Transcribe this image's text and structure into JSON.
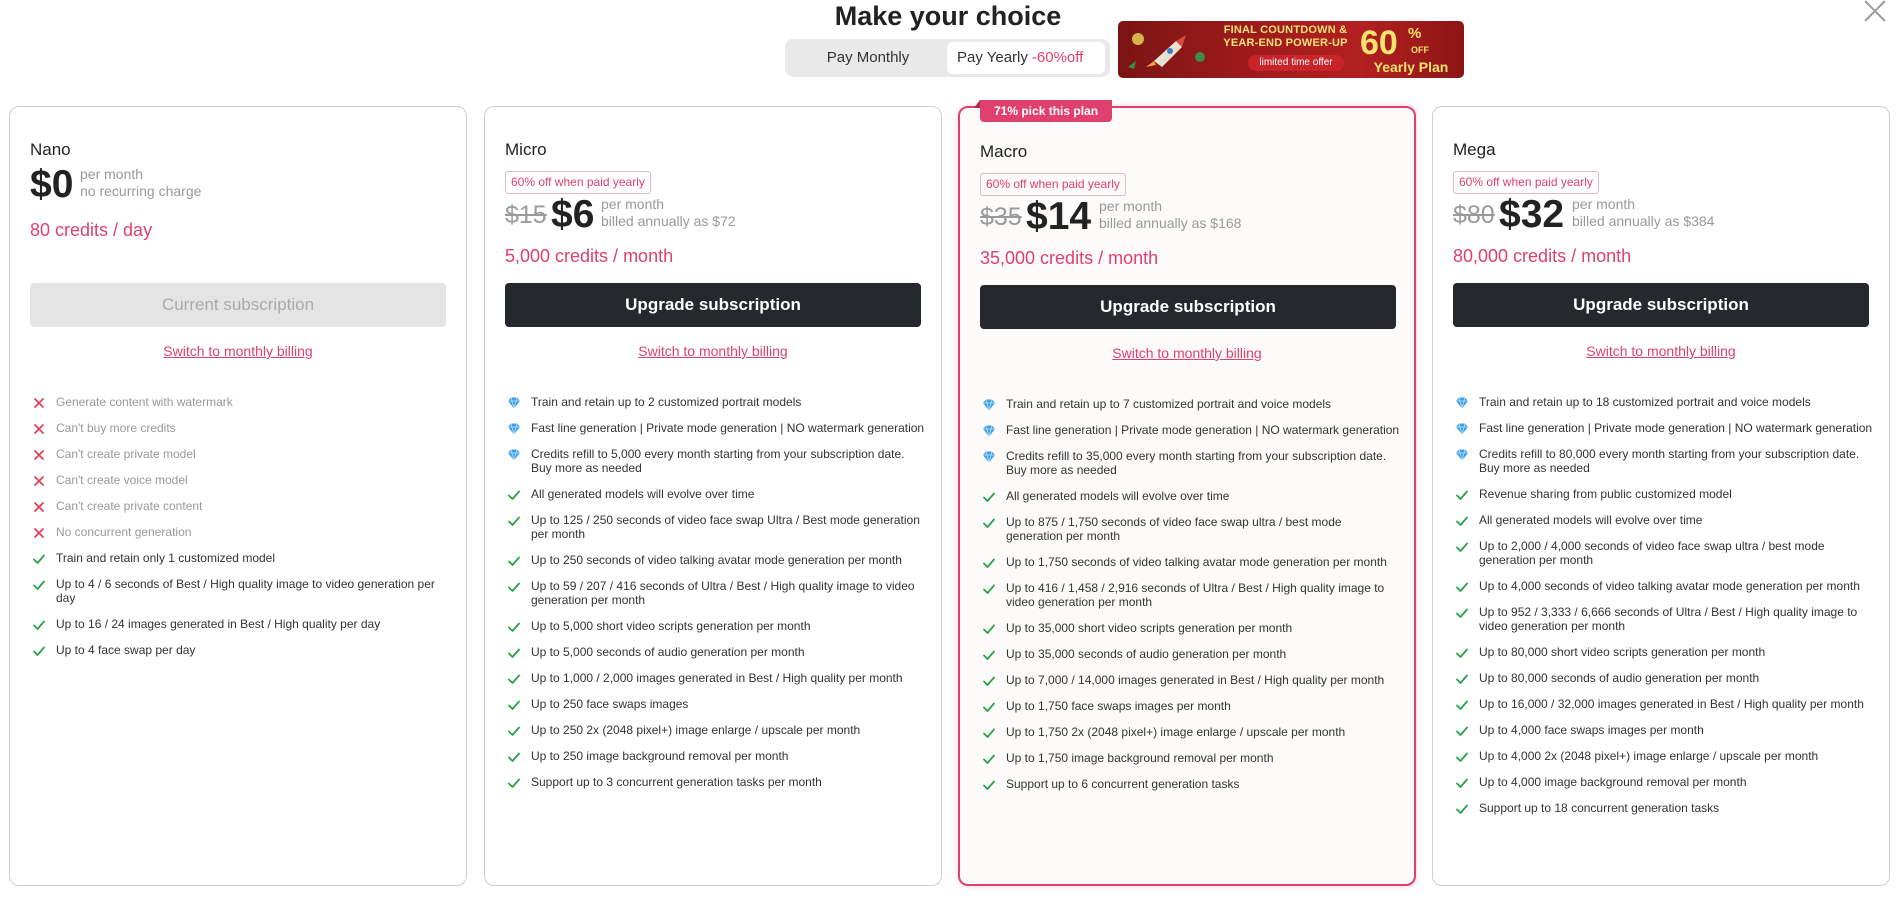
{
  "header": {
    "title": "Make your choice",
    "toggle_monthly": "Pay Monthly",
    "toggle_yearly": "Pay Yearly",
    "toggle_discount": "-60%off"
  },
  "banner": {
    "headline_1": "FINAL COUNTDOWN &",
    "headline_2": "YEAR-END POWER-UP",
    "pill": "limited time offer",
    "big_number": "60",
    "percent": "%",
    "off": "OFF",
    "plan": "Yearly Plan"
  },
  "colors": {
    "accent": "#e0406d",
    "button_dark": "#25282d",
    "check_green": "#2aa14a",
    "cross_red": "#e0405a",
    "diamond_blue": "#3da0e8"
  },
  "plans": [
    {
      "name": "Nano",
      "tag": "",
      "orig_price": "",
      "price": "$0",
      "per_line1": "per month",
      "per_line2": "no recurring charge",
      "credits": "80 credits / day",
      "button": "Current subscription",
      "switch_link": "Switch to monthly billing",
      "features": [
        {
          "icon": "cross-icon",
          "text": "Generate content with watermark"
        },
        {
          "icon": "cross-icon",
          "text": "Can't buy more credits"
        },
        {
          "icon": "cross-icon",
          "text": "Can't create private model"
        },
        {
          "icon": "cross-icon",
          "text": "Can't create voice model"
        },
        {
          "icon": "cross-icon",
          "text": "Can't create private content"
        },
        {
          "icon": "cross-icon",
          "text": "No concurrent generation"
        },
        {
          "icon": "check-icon",
          "text": "Train and retain only 1 customized model"
        },
        {
          "icon": "check-icon",
          "text": "Up to 4 / 6 seconds of Best / High quality image to video generation per day"
        },
        {
          "icon": "check-icon",
          "text": "Up to 16 / 24 images generated in Best / High quality per day"
        },
        {
          "icon": "check-icon",
          "text": "Up to 4 face swap per day"
        }
      ]
    },
    {
      "name": "Micro",
      "tag": "60% off when paid yearly",
      "orig_price": "$15",
      "price": "$6",
      "per_line1": "per month",
      "per_line2": "billed annually as $72",
      "credits": "5,000 credits / month",
      "button": "Upgrade subscription",
      "switch_link": "Switch to monthly billing",
      "features": [
        {
          "icon": "diamond-icon",
          "text": "Train and retain up to 2 customized portrait models"
        },
        {
          "icon": "diamond-icon",
          "text": "Fast line generation | Private mode generation | NO watermark generation"
        },
        {
          "icon": "diamond-icon",
          "text": "Credits refill to 5,000 every month starting from your subscription date. Buy more as needed"
        },
        {
          "icon": "check-icon",
          "text": "All generated models will evolve over time"
        },
        {
          "icon": "check-icon",
          "text": "Up to 125 / 250 seconds of video face swap Ultra / Best mode generation per month"
        },
        {
          "icon": "check-icon",
          "text": "Up to 250 seconds of video talking avatar mode generation per month"
        },
        {
          "icon": "check-icon",
          "text": "Up to 59 / 207 / 416 seconds of Ultra / Best / High quality image to video generation per month"
        },
        {
          "icon": "check-icon",
          "text": "Up to 5,000 short video scripts generation per month"
        },
        {
          "icon": "check-icon",
          "text": "Up to 5,000 seconds of audio generation per month"
        },
        {
          "icon": "check-icon",
          "text": "Up to 1,000 / 2,000 images generated in Best / High quality per month"
        },
        {
          "icon": "check-icon",
          "text": "Up to 250 face swaps images"
        },
        {
          "icon": "check-icon",
          "text": "Up to 250 2x (2048 pixel+) image enlarge / upscale per month"
        },
        {
          "icon": "check-icon",
          "text": "Up to 250 image background removal per month"
        },
        {
          "icon": "check-icon",
          "text": "Support up to 3 concurrent generation tasks per month"
        }
      ]
    },
    {
      "name": "Macro",
      "ribbon": "71% pick this plan",
      "tag": "60% off when paid yearly",
      "orig_price": "$35",
      "price": "$14",
      "per_line1": "per month",
      "per_line2": "billed annually as $168",
      "credits": "35,000 credits / month",
      "button": "Upgrade subscription",
      "switch_link": "Switch to monthly billing",
      "features": [
        {
          "icon": "diamond-icon",
          "text": "Train and retain up to 7 customized portrait and voice models"
        },
        {
          "icon": "diamond-icon",
          "text": "Fast line generation | Private mode generation | NO watermark generation"
        },
        {
          "icon": "diamond-icon",
          "text": "Credits refill to 35,000 every month starting from your subscription date. Buy more as needed"
        },
        {
          "icon": "check-icon",
          "text": "All generated models will evolve over time"
        },
        {
          "icon": "check-icon",
          "text": "Up to 875 / 1,750 seconds of video face swap ultra / best mode generation per month"
        },
        {
          "icon": "check-icon",
          "text": "Up to 1,750 seconds of video talking avatar mode generation per month"
        },
        {
          "icon": "check-icon",
          "text": "Up to 416 / 1,458 / 2,916 seconds of Ultra / Best / High quality image to video generation per month"
        },
        {
          "icon": "check-icon",
          "text": "Up to 35,000 short video scripts generation per month"
        },
        {
          "icon": "check-icon",
          "text": "Up to 35,000 seconds of audio generation per month"
        },
        {
          "icon": "check-icon",
          "text": "Up to 7,000 / 14,000 images generated in Best / High quality per month"
        },
        {
          "icon": "check-icon",
          "text": "Up to 1,750 face swaps images per month"
        },
        {
          "icon": "check-icon",
          "text": "Up to 1,750 2x (2048 pixel+) image enlarge / upscale per month"
        },
        {
          "icon": "check-icon",
          "text": "Up to 1,750 image background removal per month"
        },
        {
          "icon": "check-icon",
          "text": "Support up to 6 concurrent generation tasks"
        }
      ]
    },
    {
      "name": "Mega",
      "tag": "60% off when paid yearly",
      "orig_price": "$80",
      "price": "$32",
      "per_line1": "per month",
      "per_line2": "billed annually as $384",
      "credits": "80,000 credits / month",
      "button": "Upgrade subscription",
      "switch_link": "Switch to monthly billing",
      "features": [
        {
          "icon": "diamond-icon",
          "text": "Train and retain up to 18 customized portrait and voice models"
        },
        {
          "icon": "diamond-icon",
          "text": "Fast line generation | Private mode generation | NO watermark generation"
        },
        {
          "icon": "diamond-icon",
          "text": "Credits refill to 80,000 every month starting from your subscription date. Buy more as needed"
        },
        {
          "icon": "check-icon",
          "text": "Revenue sharing from public customized model"
        },
        {
          "icon": "check-icon",
          "text": "All generated models will evolve over time"
        },
        {
          "icon": "check-icon",
          "text": "Up to 2,000 / 4,000 seconds of video face swap ultra / best mode generation per month"
        },
        {
          "icon": "check-icon",
          "text": "Up to 4,000 seconds of video talking avatar mode generation per month"
        },
        {
          "icon": "check-icon",
          "text": "Up to 952 / 3,333 / 6,666 seconds of Ultra / Best / High quality image to video generation per month"
        },
        {
          "icon": "check-icon",
          "text": "Up to 80,000 short video scripts generation per month"
        },
        {
          "icon": "check-icon",
          "text": "Up to 80,000 seconds of audio generation per month"
        },
        {
          "icon": "check-icon",
          "text": "Up to 16,000 / 32,000 images generated in Best / High quality per month"
        },
        {
          "icon": "check-icon",
          "text": "Up to 4,000 face swaps images per month"
        },
        {
          "icon": "check-icon",
          "text": "Up to 4,000 2x (2048 pixel+) image enlarge / upscale per month"
        },
        {
          "icon": "check-icon",
          "text": "Up to 4,000 image background removal per month"
        },
        {
          "icon": "check-icon",
          "text": "Support up to 18 concurrent generation tasks"
        }
      ]
    }
  ]
}
